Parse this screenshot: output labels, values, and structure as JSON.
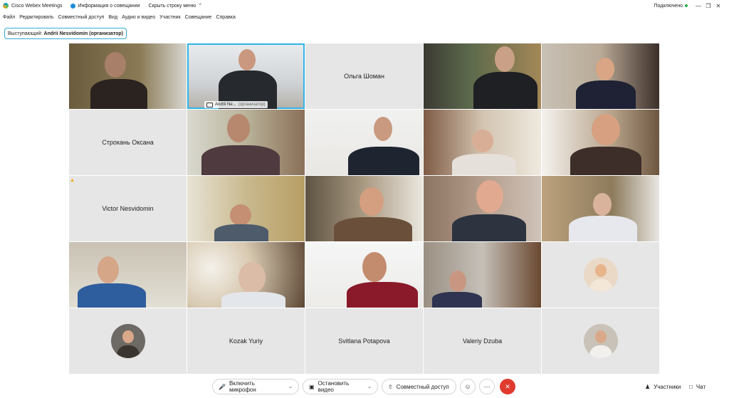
{
  "titlebar": {
    "app_name": "Cisco Webex Meetings",
    "meeting_info": "Информация о совещании",
    "hide_menu": "Скрыть строку меню",
    "status": "Подключено"
  },
  "menu": [
    "Файл",
    "Редактировать",
    "Совместный доступ",
    "Вид",
    "Аудио и видео",
    "Участник",
    "Совещание",
    "Справка"
  ],
  "speaker": {
    "label": "Выступающий:",
    "name": "Andrii Nesvidomin (организатор)"
  },
  "tiles": [
    {
      "type": "video"
    },
    {
      "type": "video",
      "label_name": "Andrii Ne...",
      "label_role": "(организатор)"
    },
    {
      "type": "name",
      "name": "Ольга Шоман"
    },
    {
      "type": "video"
    },
    {
      "type": "video"
    },
    {
      "type": "name",
      "name": "Строкань Оксана"
    },
    {
      "type": "video"
    },
    {
      "type": "video"
    },
    {
      "type": "video"
    },
    {
      "type": "video"
    },
    {
      "type": "name",
      "name": "Victor Nesvidomin"
    },
    {
      "type": "video"
    },
    {
      "type": "video"
    },
    {
      "type": "video"
    },
    {
      "type": "video"
    },
    {
      "type": "video"
    },
    {
      "type": "video"
    },
    {
      "type": "video"
    },
    {
      "type": "video"
    },
    {
      "type": "avatar"
    },
    {
      "type": "avatar"
    },
    {
      "type": "name",
      "name": "Kozak Yuriy"
    },
    {
      "type": "name",
      "name": "Svitlana Potapova"
    },
    {
      "type": "name",
      "name": "Valeriy Dzuba"
    },
    {
      "type": "avatar"
    }
  ],
  "controls": {
    "mic": "Включить микрофон",
    "video": "Остановить видео",
    "share": "Совместный доступ",
    "participants": "Участники",
    "chat": "Чат"
  },
  "colors": {
    "accent": "#2fb5e5",
    "end_call": "#e03a2f",
    "connected": "#2bb24c"
  }
}
